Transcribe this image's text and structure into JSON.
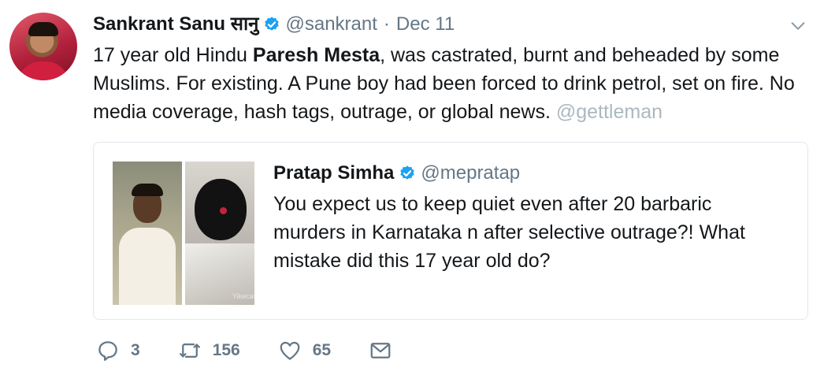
{
  "tweet": {
    "author_name": "Sankrant Sanu सानु",
    "handle": "@sankrant",
    "separator": "·",
    "date": "Dec 11",
    "text_part1": "17 year old Hindu ",
    "text_bold": "Paresh Mesta",
    "text_part2": ", was castrated, burnt and beheaded by some Muslims. For existing. A Pune boy had been forced to drink petrol, set on fire. No media coverage, hash tags, outrage, or global news. ",
    "mention": "@gettleman"
  },
  "quoted_tweet": {
    "author_name": "Pratap Simha",
    "handle": "@mepratap",
    "text": "You expect us to keep quiet even after 20 barbaric murders in Karnataka n after selective outrage?! What mistake did this 17 year old do?",
    "image_watermark": "Yikecast"
  },
  "actions": {
    "replies": "3",
    "retweets": "156",
    "likes": "65"
  },
  "icons": {
    "verified": "verified-badge-icon",
    "caret": "chevron-down-icon",
    "reply": "reply-icon",
    "retweet": "retweet-icon",
    "like": "heart-icon",
    "dm": "envelope-icon"
  },
  "colors": {
    "verified_blue": "#1da1f2",
    "secondary_text": "#657786",
    "mention": "#aab8c2",
    "border": "#e1e8ed"
  }
}
